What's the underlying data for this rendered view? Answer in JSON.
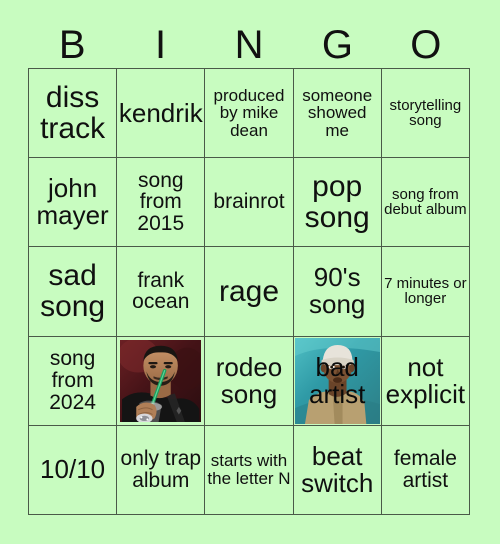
{
  "card": {
    "title": "BINGO",
    "background_color": "#c8fcc0",
    "border_color": "#4a5a48",
    "text_color": "#101010"
  },
  "header": {
    "letters": [
      "B",
      "I",
      "N",
      "G",
      "O"
    ]
  },
  "grid": {
    "rows": 5,
    "columns": 5,
    "cells": [
      [
        {
          "text": "diss track",
          "size": "fs-xl",
          "type": "text"
        },
        {
          "text": "kendrik",
          "size": "fs-lg",
          "type": "text"
        },
        {
          "text": "produced by mike dean",
          "size": "fs-sm",
          "type": "text"
        },
        {
          "text": "someone showed me",
          "size": "fs-sm",
          "type": "text"
        },
        {
          "text": "storytelling song",
          "size": "fs-xs",
          "type": "text"
        }
      ],
      [
        {
          "text": "john mayer",
          "size": "fs-lg",
          "type": "text"
        },
        {
          "text": "song from 2015",
          "size": "fs-md",
          "type": "text"
        },
        {
          "text": "brainrot",
          "size": "fs-md",
          "type": "text"
        },
        {
          "text": "pop song",
          "size": "fs-xl",
          "type": "text"
        },
        {
          "text": "song from debut album",
          "size": "fs-xs",
          "type": "text"
        }
      ],
      [
        {
          "text": "sad song",
          "size": "fs-xl",
          "type": "text"
        },
        {
          "text": "frank ocean",
          "size": "fs-md",
          "type": "text"
        },
        {
          "text": "rage",
          "size": "fs-xl",
          "type": "text"
        },
        {
          "text": "90's song",
          "size": "fs-lg",
          "type": "text"
        },
        {
          "text": "7 minutes or longer",
          "size": "fs-xs",
          "type": "text"
        }
      ],
      [
        {
          "text": "song from 2024",
          "size": "fs-md",
          "type": "text"
        },
        {
          "text": "",
          "size": "fs-md",
          "type": "image",
          "image": "drake-drinking-photo",
          "image_desc": "photo of a man with a beard drinking through a green straw, dark red background"
        },
        {
          "text": "rodeo song",
          "size": "fs-lg",
          "type": "text"
        },
        {
          "text": "bad artist",
          "size": "fs-lg",
          "type": "image-text",
          "image": "rapper-teal-photo",
          "image_desc": "photo of a young rapper in a cap against a teal background"
        },
        {
          "text": "not explicit",
          "size": "fs-lg",
          "type": "text"
        }
      ],
      [
        {
          "text": "10/10",
          "size": "fs-lg",
          "type": "text"
        },
        {
          "text": "only trap album",
          "size": "fs-md",
          "type": "text"
        },
        {
          "text": "starts with the letter N",
          "size": "fs-sm",
          "type": "text"
        },
        {
          "text": "beat switch",
          "size": "fs-lg",
          "type": "text"
        },
        {
          "text": "female artist",
          "size": "fs-md",
          "type": "text"
        }
      ]
    ]
  }
}
